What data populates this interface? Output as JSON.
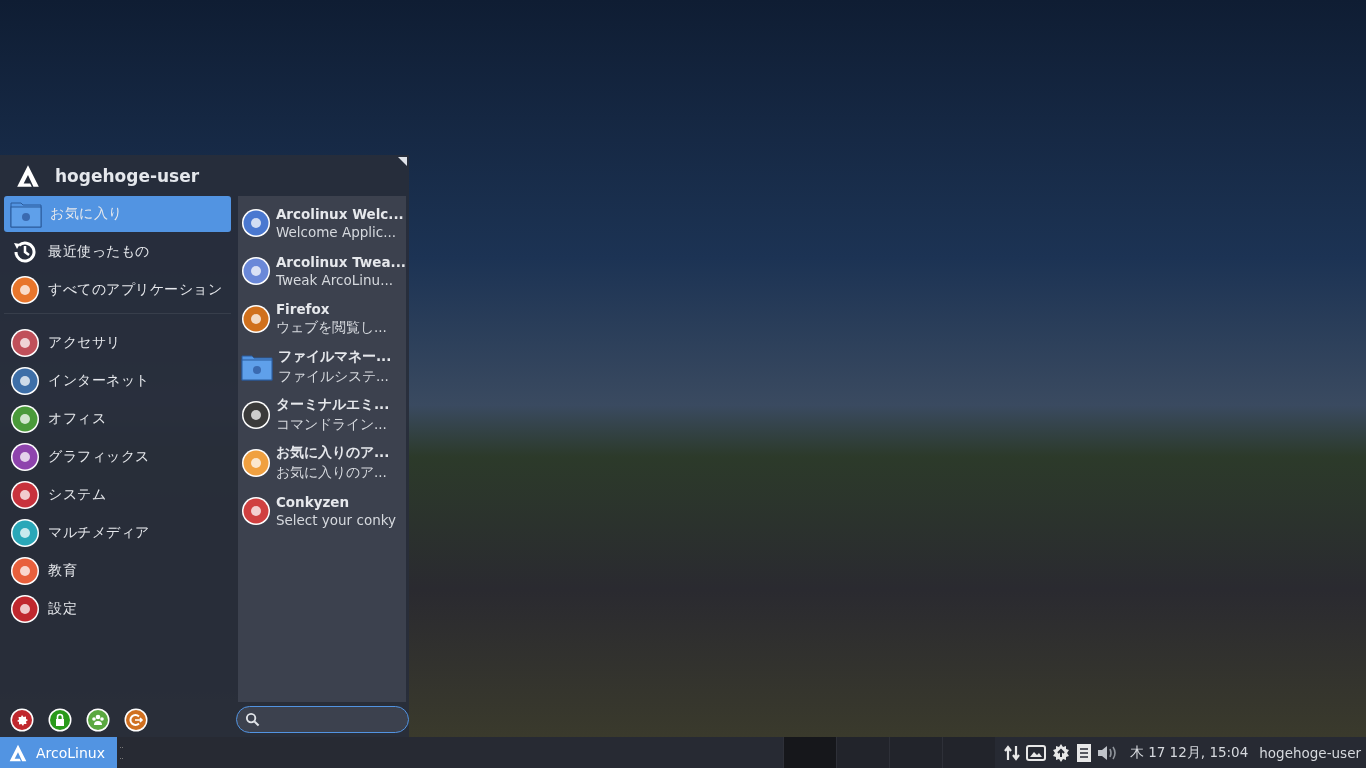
{
  "menu": {
    "username": "hogehoge-user",
    "categories": [
      {
        "label": "お気に入り",
        "selected": true,
        "kind": "folder",
        "color": "#5294e2"
      },
      {
        "label": "最近使ったもの",
        "selected": false,
        "kind": "history",
        "color": "#ffffff"
      },
      {
        "label": "すべてのアプリケーション",
        "selected": false,
        "kind": "circle",
        "color": "#e8762c"
      },
      {
        "label": "アクセサリ",
        "selected": false,
        "kind": "circle",
        "color": "#c0505a",
        "separated": true
      },
      {
        "label": "インターネット",
        "selected": false,
        "kind": "circle",
        "color": "#3e6fa8"
      },
      {
        "label": "オフィス",
        "selected": false,
        "kind": "circle",
        "color": "#4a9a3a"
      },
      {
        "label": "グラフィックス",
        "selected": false,
        "kind": "circle",
        "color": "#8e44ad"
      },
      {
        "label": "システム",
        "selected": false,
        "kind": "circle",
        "color": "#c8323c"
      },
      {
        "label": "マルチメディア",
        "selected": false,
        "kind": "circle",
        "color": "#2aa7b8"
      },
      {
        "label": "教育",
        "selected": false,
        "kind": "circle",
        "color": "#e8603c"
      },
      {
        "label": "設定",
        "selected": false,
        "kind": "circle",
        "color": "#c0282e"
      }
    ],
    "apps": [
      {
        "name": "Arcolinux Welc...",
        "description": "Welcome Applic...",
        "kind": "circle",
        "color": "#4a78d0"
      },
      {
        "name": "Arcolinux Twea...",
        "description": "Tweak ArcoLinu...",
        "kind": "circle",
        "color": "#6a88d8"
      },
      {
        "name": "Firefox",
        "description": "ウェブを閲覧し...",
        "kind": "circle",
        "color": "#d0701c"
      },
      {
        "name": "ファイルマネー...",
        "description": "ファイルシステ...",
        "kind": "folder",
        "color": "#5294e2"
      },
      {
        "name": "ターミナルエミ...",
        "description": "コマンドライン...",
        "kind": "circle",
        "color": "#3a3a3a"
      },
      {
        "name": "お気に入りのア...",
        "description": "お気に入りのア...",
        "kind": "circle",
        "color": "#f0a040"
      },
      {
        "name": "Conkyzen",
        "description": "Select your conky",
        "kind": "circle",
        "color": "#d04040"
      }
    ],
    "actions": [
      {
        "kind": "settings",
        "color": "#c0282e"
      },
      {
        "kind": "lock",
        "color": "#2a9a1a"
      },
      {
        "kind": "users",
        "color": "#5aa840"
      },
      {
        "kind": "logout",
        "color": "#d07020"
      }
    ]
  },
  "taskbar": {
    "start_label": "ArcoLinux",
    "clock": "木 17 12月, 15:04",
    "user": "hogehoge-user"
  }
}
